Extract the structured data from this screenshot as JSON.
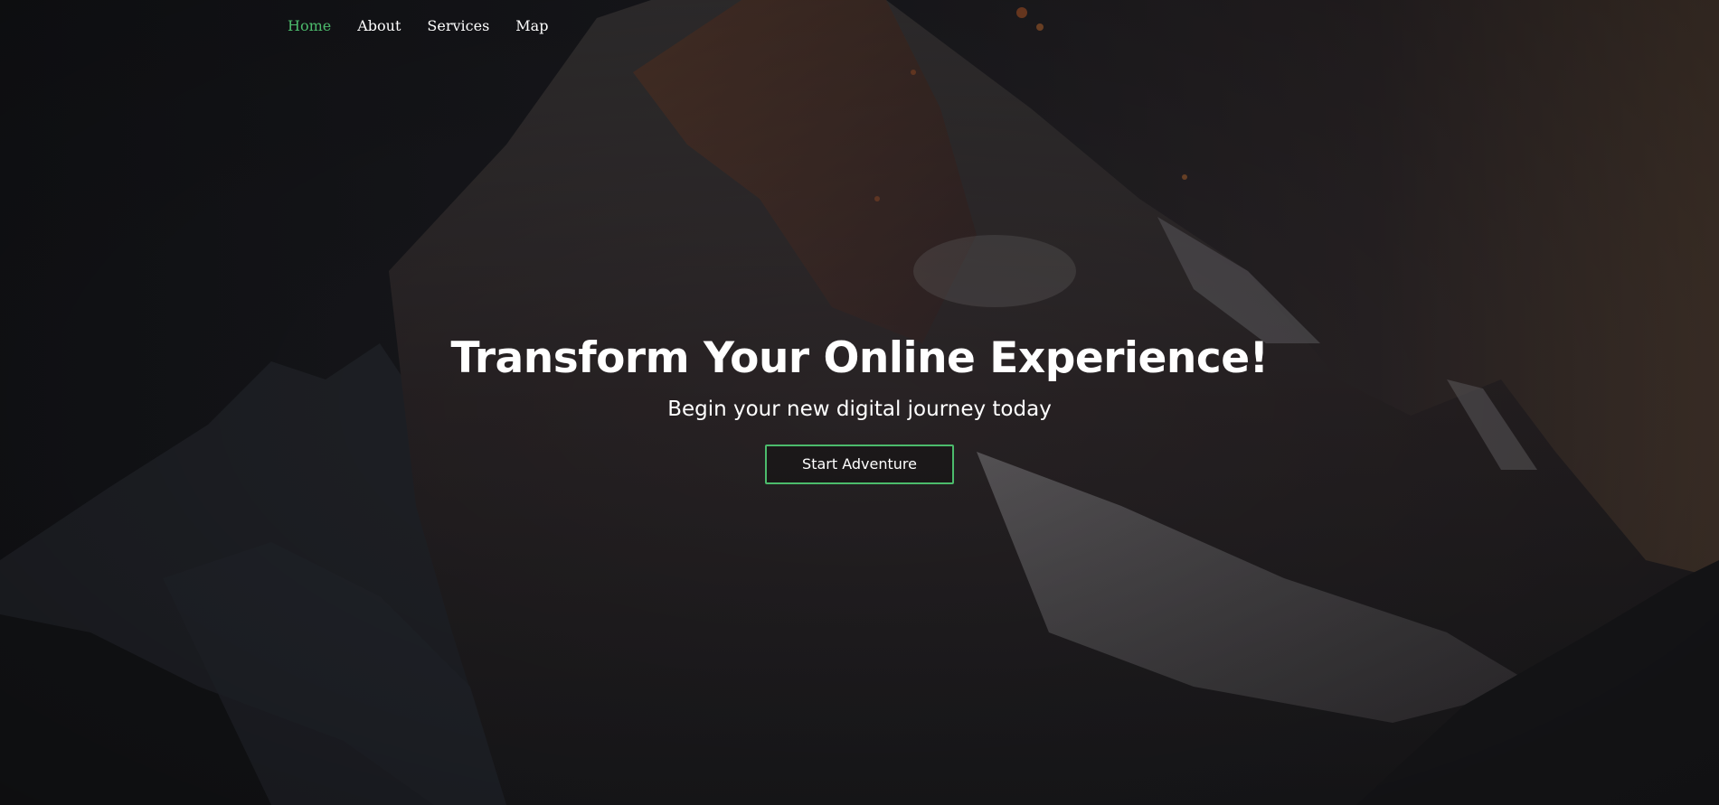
{
  "nav": {
    "items": [
      {
        "label": "Home",
        "active": true
      },
      {
        "label": "About",
        "active": false
      },
      {
        "label": "Services",
        "active": false
      },
      {
        "label": "Map",
        "active": false
      }
    ]
  },
  "hero": {
    "title": "Transform Your Online Experience!",
    "subtitle": "Begin your new digital journey today",
    "cta_label": "Start Adventure"
  },
  "colors": {
    "accent": "#4cbb6c",
    "text": "#ffffff",
    "background": "#17181c"
  }
}
